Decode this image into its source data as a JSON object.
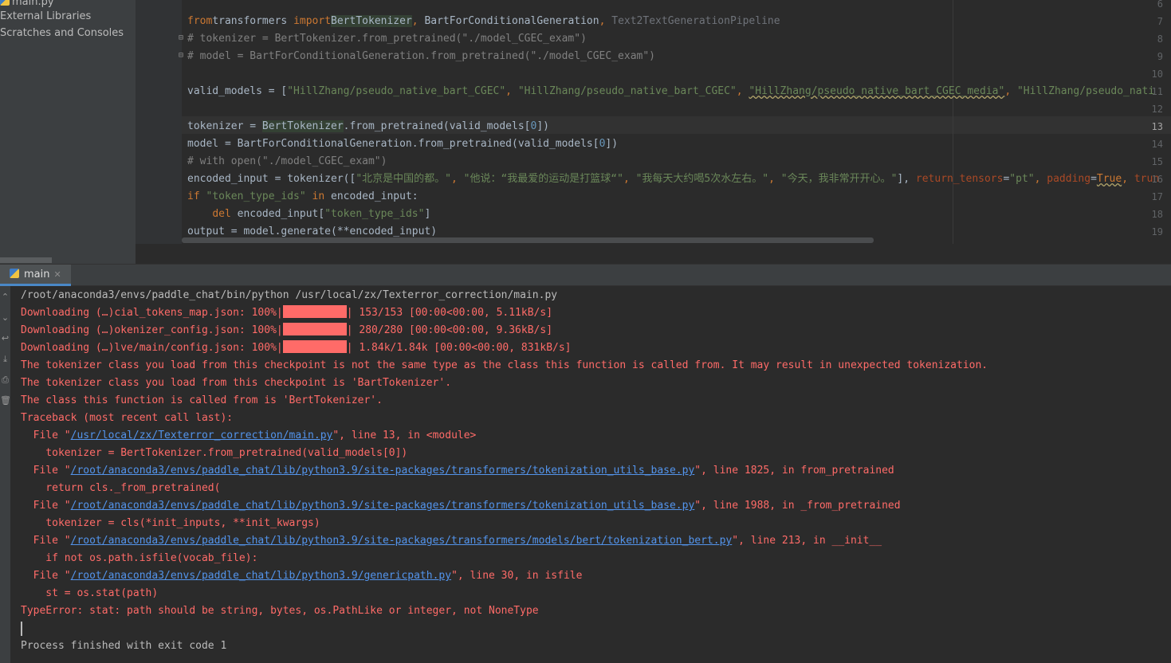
{
  "sidebar": {
    "items": [
      "main.py",
      "External Libraries",
      "Scratches and Consoles"
    ]
  },
  "editor": {
    "current_line": 13,
    "line_numbers": [
      "6",
      "7",
      "8",
      "9",
      "10",
      "11",
      "12",
      "13",
      "14",
      "15",
      "16",
      "17",
      "18",
      "19"
    ],
    "lines": [
      [],
      [
        [
          "kw",
          "from"
        ],
        [
          "",
          "transformers "
        ],
        [
          "kw",
          "import"
        ],
        [
          "hl",
          "BertTokenizer"
        ],
        [
          "kw",
          ", "
        ],
        [
          "",
          "BartForConditionalGeneration"
        ],
        [
          "kw",
          ", "
        ],
        [
          "gray",
          "Text2TextGenerationPipeline"
        ]
      ],
      [
        [
          "cmt",
          "# tokenizer = BertTokenizer.from_pretrained(\"./model_CGEC_exam\")"
        ]
      ],
      [
        [
          "cmt",
          "# model = BartForConditionalGeneration.from_pretrained(\"./model_CGEC_exam\")"
        ]
      ],
      [],
      [
        [
          "",
          "valid_models = ["
        ],
        [
          "str",
          "\"HillZhang/pseudo_native_bart_CGEC\""
        ],
        [
          "kw",
          ", "
        ],
        [
          "str",
          "\"HillZhang/pseudo_native_bart_CGEC\""
        ],
        [
          "kw",
          ", "
        ],
        [
          "strsq",
          "\"HillZhang/pseudo_native_bart_CGEC_media\""
        ],
        [
          "kw",
          ", "
        ],
        [
          "str",
          "\"HillZhang/pseudo_nati"
        ]
      ],
      [],
      [
        [
          "",
          "tokenizer = "
        ],
        [
          "hl",
          "BertTokenizer"
        ],
        [
          "",
          ".from_pretrained(valid_models["
        ],
        [
          "num",
          "0"
        ],
        [
          "",
          "])"
        ]
      ],
      [
        [
          "",
          "model = BartForConditionalGeneration.from_pretrained(valid_models["
        ],
        [
          "num",
          "0"
        ],
        [
          "",
          "])"
        ]
      ],
      [
        [
          "cmt",
          "# with open(\"./model_CGEC_exam\")"
        ]
      ],
      [
        [
          "",
          "encoded_input = tokenizer(["
        ],
        [
          "str",
          "\"北京是中国的都。\""
        ],
        [
          "kw",
          ", "
        ],
        [
          "str",
          "\"他说：“我最爱的运动是打篮球“\""
        ],
        [
          "kw",
          ", "
        ],
        [
          "str",
          "\"我每天大约喝5次水左右。\""
        ],
        [
          "kw",
          ", "
        ],
        [
          "str",
          "\"今天，我非常开开心。\""
        ],
        [
          "",
          "], "
        ],
        [
          "param",
          "return_tensors"
        ],
        [
          "",
          "="
        ],
        [
          "str",
          "\"pt\""
        ],
        [
          "kw",
          ", "
        ],
        [
          "param",
          "padding"
        ],
        [
          "",
          "="
        ],
        [
          "kwsq",
          "True"
        ],
        [
          "kw",
          ", "
        ],
        [
          "param",
          "trun"
        ]
      ],
      [
        [
          "kw",
          "if "
        ],
        [
          "str",
          "\"token_type_ids\""
        ],
        [
          "kw",
          " in "
        ],
        [
          "",
          "encoded_input:"
        ]
      ],
      [
        [
          "",
          "    "
        ],
        [
          "kw",
          "del "
        ],
        [
          "",
          "encoded_input["
        ],
        [
          "str",
          "\"token_type_ids\""
        ],
        [
          "",
          "]"
        ]
      ],
      [
        [
          "",
          "output = model.generate(**encoded_input)"
        ]
      ]
    ]
  },
  "run": {
    "tab_label": "main",
    "lines": [
      {
        "style": "normal",
        "segs": [
          [
            "t",
            "/root/anaconda3/envs/paddle_chat/bin/python /usr/local/zx/Texterror_correction/main.py"
          ]
        ]
      },
      {
        "style": "err",
        "segs": [
          [
            "t",
            "Downloading (…)cial_tokens_map.json: 100%|"
          ],
          [
            "bar",
            ""
          ],
          [
            "t",
            "| 153/153 [00:00<00:00, 5.11kB/s]"
          ]
        ]
      },
      {
        "style": "err",
        "segs": [
          [
            "t",
            "Downloading (…)okenizer_config.json: 100%|"
          ],
          [
            "bar",
            ""
          ],
          [
            "t",
            "| 280/280 [00:00<00:00, 9.36kB/s]"
          ]
        ]
      },
      {
        "style": "err",
        "segs": [
          [
            "t",
            "Downloading (…)lve/main/config.json: 100%|"
          ],
          [
            "bar",
            ""
          ],
          [
            "t",
            "| 1.84k/1.84k [00:00<00:00, 831kB/s]"
          ]
        ]
      },
      {
        "style": "err",
        "segs": [
          [
            "t",
            "The tokenizer class you load from this checkpoint is not the same type as the class this function is called from. It may result in unexpected tokenization."
          ]
        ]
      },
      {
        "style": "err",
        "segs": [
          [
            "t",
            "The tokenizer class you load from this checkpoint is 'BartTokenizer'."
          ]
        ]
      },
      {
        "style": "err",
        "segs": [
          [
            "t",
            "The class this function is called from is 'BertTokenizer'."
          ]
        ]
      },
      {
        "style": "err",
        "segs": [
          [
            "t",
            "Traceback (most recent call last):"
          ]
        ]
      },
      {
        "style": "err",
        "segs": [
          [
            "t",
            "  File \""
          ],
          [
            "link",
            "/usr/local/zx/Texterror_correction/main.py"
          ],
          [
            "t",
            "\", line 13, in <module>"
          ]
        ]
      },
      {
        "style": "err",
        "segs": [
          [
            "t",
            "    tokenizer = BertTokenizer.from_pretrained(valid_models[0])"
          ]
        ]
      },
      {
        "style": "err",
        "segs": [
          [
            "t",
            "  File \""
          ],
          [
            "link",
            "/root/anaconda3/envs/paddle_chat/lib/python3.9/site-packages/transformers/tokenization_utils_base.py"
          ],
          [
            "t",
            "\", line 1825, in from_pretrained"
          ]
        ]
      },
      {
        "style": "err",
        "segs": [
          [
            "t",
            "    return cls._from_pretrained("
          ]
        ]
      },
      {
        "style": "err",
        "segs": [
          [
            "t",
            "  File \""
          ],
          [
            "link",
            "/root/anaconda3/envs/paddle_chat/lib/python3.9/site-packages/transformers/tokenization_utils_base.py"
          ],
          [
            "t",
            "\", line 1988, in _from_pretrained"
          ]
        ]
      },
      {
        "style": "err",
        "segs": [
          [
            "t",
            "    tokenizer = cls(*init_inputs, **init_kwargs)"
          ]
        ]
      },
      {
        "style": "err",
        "segs": [
          [
            "t",
            "  File \""
          ],
          [
            "link",
            "/root/anaconda3/envs/paddle_chat/lib/python3.9/site-packages/transformers/models/bert/tokenization_bert.py"
          ],
          [
            "t",
            "\", line 213, in __init__"
          ]
        ]
      },
      {
        "style": "err",
        "segs": [
          [
            "t",
            "    if not os.path.isfile(vocab_file):"
          ]
        ]
      },
      {
        "style": "err",
        "segs": [
          [
            "t",
            "  File \""
          ],
          [
            "link",
            "/root/anaconda3/envs/paddle_chat/lib/python3.9/genericpath.py"
          ],
          [
            "t",
            "\", line 30, in isfile"
          ]
        ]
      },
      {
        "style": "err",
        "segs": [
          [
            "t",
            "    st = os.stat(path)"
          ]
        ]
      },
      {
        "style": "err",
        "segs": [
          [
            "t",
            "TypeError: stat: path should be string, bytes, os.PathLike or integer, not NoneType"
          ]
        ]
      },
      {
        "style": "normal",
        "segs": []
      },
      {
        "style": "normal",
        "segs": [
          [
            "t",
            "Process finished with exit code 1"
          ]
        ]
      }
    ]
  },
  "colors": {
    "background": "#2b2b2b",
    "error_text": "#ff6b68",
    "link": "#5394ec",
    "keyword": "#cc7832",
    "string": "#6a8759",
    "tab_accent": "#4a88c7"
  },
  "icons": {
    "python_file": "python-icon",
    "tab_close": "close-icon"
  }
}
